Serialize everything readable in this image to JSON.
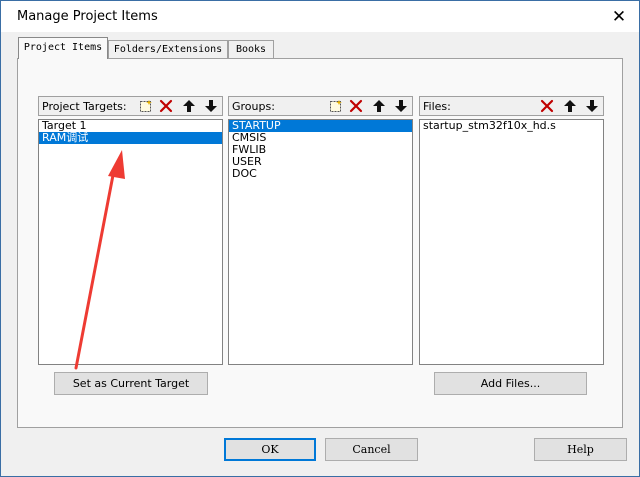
{
  "dialog": {
    "title": "Manage Project Items",
    "close_glyph": "✕"
  },
  "tabs": [
    {
      "label": "Project Items",
      "active": true
    },
    {
      "label": "Folders/Extensions",
      "active": false
    },
    {
      "label": "Books",
      "active": false
    }
  ],
  "targets": {
    "label": "Project Targets:",
    "items": [
      "Target 1",
      "RAM调试"
    ],
    "selected": "RAM调试"
  },
  "groups": {
    "label": "Groups:",
    "items": [
      "STARTUP",
      "CMSIS",
      "FWLIB",
      "USER",
      "DOC"
    ],
    "selected": "STARTUP"
  },
  "files": {
    "label": "Files:",
    "items": [
      "startup_stm32f10x_hd.s"
    ]
  },
  "buttons": {
    "set_current": "Set as Current Target",
    "add_files": "Add Files...",
    "ok": "OK",
    "cancel": "Cancel",
    "help": "Help"
  },
  "toolbar_icons": {
    "new": "new-item-icon",
    "delete": "delete-icon",
    "up": "move-up-icon",
    "down": "move-down-icon"
  },
  "colors": {
    "selection": "#0078d7",
    "annotation_arrow": "#ee3b33",
    "delete_icon": "#c00000"
  }
}
